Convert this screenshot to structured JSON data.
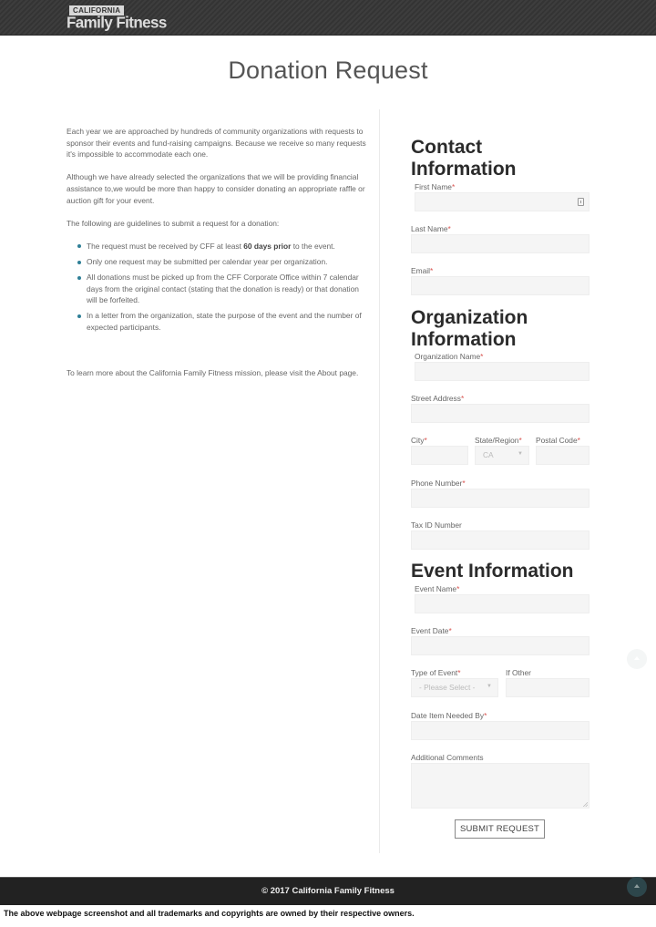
{
  "header": {
    "logo_top": "CALIFORNIA",
    "logo_bottom": "Family Fitness"
  },
  "page_title": "Donation Request",
  "intro": {
    "paragraphs": [
      "Each year we are approached by hundreds of community organizations with requests to sponsor their events and fund-raising campaigns. Because we receive so many requests it's impossible to accommodate each one.",
      "Although we have already selected the organizations that we will be providing financial assistance to,we would be more than happy to consider donating an appropriate raffle or auction gift for your event.",
      "The following are guidelines to submit a request for a donation:"
    ],
    "guidelines": [
      {
        "before": "The request must be received by CFF at least ",
        "bold": "60 days prior",
        "after": " to the event."
      },
      {
        "text": "Only one request may be submitted per calendar year per organization."
      },
      {
        "text": "All donations must be picked up from the CFF Corporate Office within 7 calendar days from the original contact (stating that the donation is ready) or that donation will be forfeited."
      },
      {
        "text": "In a letter from the organization, state the purpose of the event and the number of expected participants."
      }
    ],
    "mission_before": "To learn more about the California Family Fitness mission, please visit the ",
    "mission_link": "About",
    "mission_after": " page."
  },
  "form": {
    "required_mark": "*",
    "contact_heading_1": "Contact",
    "contact_heading_2": "Information",
    "first_name": "First Name",
    "last_name": "Last Name",
    "email": "Email",
    "org_heading_1": "Organization",
    "org_heading_2": "Information",
    "org_name": "Organization Name",
    "street": "Street Address",
    "city": "City",
    "state": "State/Region",
    "state_value": "CA",
    "postal": "Postal Code",
    "phone": "Phone Number",
    "tax_id": "Tax ID Number",
    "event_heading": "Event Information",
    "event_name": "Event Name",
    "event_date": "Event Date",
    "event_type": "Type of Event",
    "event_type_value": "- Please Select -",
    "if_other": "If Other",
    "date_needed": "Date Item Needed By",
    "comments": "Additional Comments",
    "submit": "SUBMIT REQUEST"
  },
  "footer": {
    "copyright": "© 2017 California Family Fitness"
  },
  "disclaimer": "The above webpage screenshot and all trademarks and copyrights are owned by their respective owners."
}
